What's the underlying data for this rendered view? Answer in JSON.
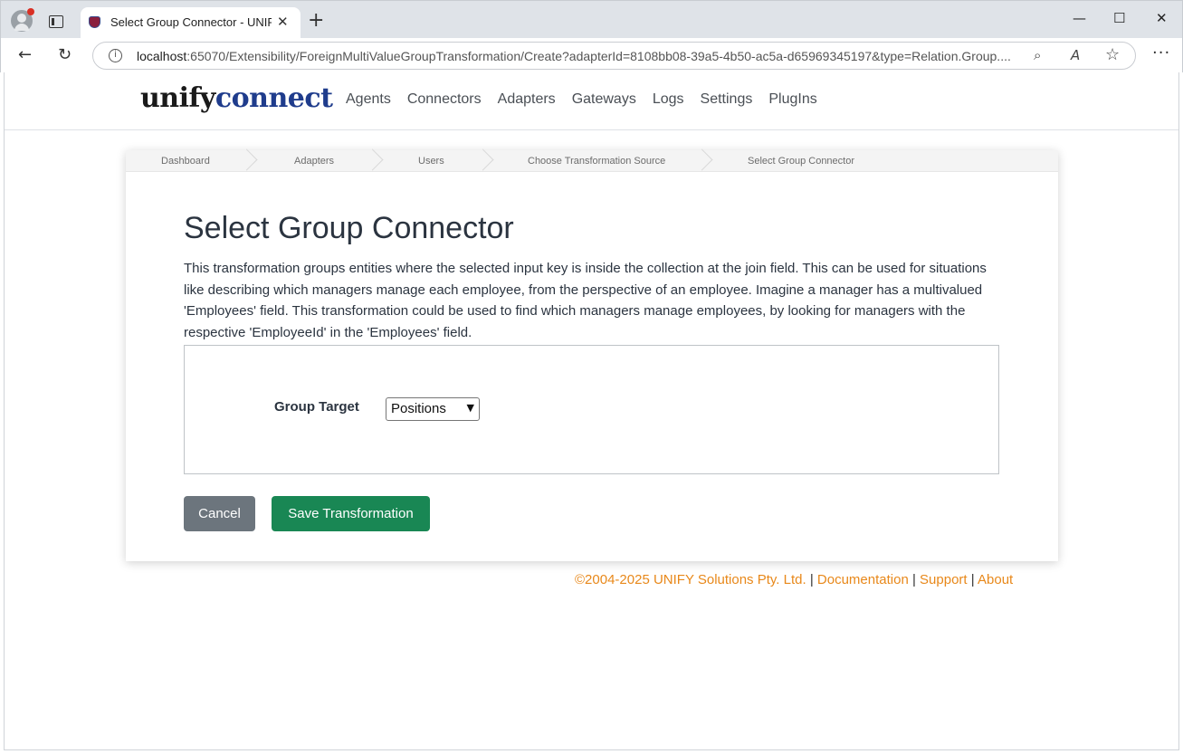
{
  "browser": {
    "tab_title": "Select Group Connector - UNIFYConnect",
    "tab_close": "✕",
    "new_tab": "+",
    "url_host": "localhost",
    "url_rest": ":65070/Extensibility/ForeignMultiValueGroupTransformation/Create?adapterId=8108bb08-39a5-4b50-ac5a-d65969345197&type=Relation.Group....",
    "minimize": "—",
    "maximize": "☐",
    "close": "✕",
    "back": "←",
    "refresh": "↻",
    "info": "i",
    "zoom": "⌕",
    "read_aloud": "A",
    "favorite": "☆",
    "more": "···"
  },
  "brand": {
    "part1": "unify",
    "part2": "connect"
  },
  "nav": {
    "items": [
      {
        "label": "Agents"
      },
      {
        "label": "Connectors"
      },
      {
        "label": "Adapters"
      },
      {
        "label": "Gateways"
      },
      {
        "label": "Logs"
      },
      {
        "label": "Settings"
      },
      {
        "label": "PlugIns"
      }
    ]
  },
  "breadcrumbs": [
    {
      "label": "Dashboard"
    },
    {
      "label": "Adapters"
    },
    {
      "label": "Users"
    },
    {
      "label": "Choose Transformation Source"
    },
    {
      "label": "Select Group Connector"
    }
  ],
  "main": {
    "title": "Select Group Connector",
    "description": "This transformation groups entities where the selected input key is inside the collection at the join field. This can be used for situations like describing which managers manage each employee, from the perspective of an employee. Imagine a manager has a multivalued 'Employees' field. This transformation could be used to find which managers manage employees, by looking for managers with the respective 'EmployeeId' in the 'Employees' field.",
    "group_target_label": "Group Target",
    "group_target_value": "Positions",
    "cancel_label": "Cancel",
    "save_label": "Save Transformation"
  },
  "footer": {
    "copyright": "©2004-2025 UNIFY Solutions Pty. Ltd.",
    "sep": "|",
    "documentation": "Documentation",
    "support": "Support",
    "about": "About"
  },
  "colors": {
    "brand_dark": "#1a1a1a",
    "brand_blue": "#1f3c8c",
    "cancel_button": "#6c757d",
    "save_button": "#198754",
    "footer_link": "#e8881a"
  }
}
